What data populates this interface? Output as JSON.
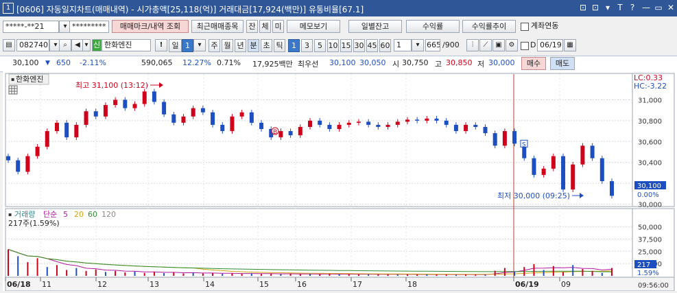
{
  "window": {
    "number": "1",
    "title": "[0606] 자동일지차트(매매내역) - 시가총액[25,118(억)] 거래대금[17,924(백만)] 유통비율[67.1]",
    "buttons": [
      "⊡",
      "⊡",
      "▾",
      "T",
      "?",
      "—",
      "▭",
      "✕"
    ]
  },
  "toolbar1": {
    "account": "*****-**21",
    "password": "*********",
    "trade_mark_btn": "매매마크/내역 조회",
    "recent_btn": "최근매매종목",
    "small_btns": [
      "잔",
      "체",
      "미"
    ],
    "memo_btn": "메모보기",
    "daily_btn": "일별잔고",
    "profit_btn": "수익률",
    "profit_rate_btn": "수익률추이",
    "link_label": "계좌연동"
  },
  "toolbar2": {
    "code": "082740",
    "badge": "신",
    "name": "한화엔진",
    "excl": "!",
    "period_day": "일",
    "period_num": "1",
    "periods": [
      "주",
      "월",
      "년",
      "분",
      "초",
      "틱"
    ],
    "intervals": [
      "1",
      "3",
      "5",
      "10",
      "15",
      "30",
      "45",
      "60"
    ],
    "interval_sel": "1",
    "count": "665",
    "count_total": "/900",
    "date_label": "D",
    "date": "06/19"
  },
  "quote": {
    "price": "30,100",
    "change": "650",
    "change_pct": "-2.11%",
    "volume": "590,065",
    "turnover_pct": "12.27%",
    "ratio": "0.71%",
    "amount": "17,925백만",
    "best_ask_label": "최우선",
    "best_ask": "30,100",
    "best_bid": "30,050",
    "open_label": "시",
    "open": "30,750",
    "high_label": "고",
    "high": "30,850",
    "low_label": "저",
    "low": "30,000",
    "buy_btn": "매수",
    "sell_btn": "매도"
  },
  "chart_data": [
    {
      "type": "candlestick",
      "title": "한화엔진",
      "price_axis": {
        "ticks": [
          "31,000",
          "30,800",
          "30,600",
          "30,400",
          "30,200",
          "30,000"
        ],
        "range": [
          29990,
          31220
        ]
      },
      "lc_label": "LC:0.33",
      "hc_label": "HC:-3.22",
      "current_price_label": "30,100",
      "current_pct_label": "0.00%",
      "high_annotation": "최고 31,100 (13:12)",
      "low_annotation": "최저 30,000 (09:25)",
      "trade_marks": [
        {
          "label": "B",
          "price": 30700
        },
        {
          "label": "S",
          "price": 30580
        }
      ],
      "x_labels": [
        "06/18",
        "11",
        "12",
        "13",
        "14",
        "15",
        "16",
        "17",
        "18",
        "06/19",
        "09"
      ],
      "time_label": "09:56:00",
      "closes": [
        30420,
        30310,
        30460,
        30550,
        30700,
        30780,
        30640,
        30760,
        30890,
        30840,
        30950,
        31000,
        30920,
        30960,
        31080,
        30980,
        30860,
        30780,
        30840,
        30920,
        30880,
        30760,
        30700,
        30840,
        30880,
        30780,
        30720,
        30640,
        30700,
        30660,
        30740,
        30800,
        30760,
        30720,
        30760,
        30780,
        30790,
        30760,
        30740,
        30760,
        30790,
        30810,
        30800,
        30820,
        30800,
        30760,
        30700,
        30760,
        30740,
        30680,
        30560,
        30700,
        30580,
        30440,
        30280,
        30340,
        30460,
        30140,
        30380,
        30560,
        30440,
        30220,
        30080
      ]
    },
    {
      "type": "bar",
      "title": "거래량",
      "ma_label": "단순",
      "ma_periods": [
        "5",
        "20",
        "60",
        "120"
      ],
      "volume_label": "217주(1.59%)",
      "axis_ticks": [
        "50,000",
        "37,500",
        "25,000",
        "12,500"
      ],
      "current_label": "217",
      "current_pct_label": "1.59%",
      "values": [
        27000,
        20000,
        14000,
        18000,
        9000,
        11000,
        6000,
        8000,
        5000,
        6500,
        4000,
        5000,
        3500,
        4500,
        3000,
        4000,
        2800,
        3500,
        2500,
        3200,
        2400,
        2800,
        2200,
        2600,
        2000,
        2400,
        1900,
        2200,
        1800,
        2100,
        1700,
        2000,
        1600,
        1900,
        1500,
        1800,
        1500,
        1700,
        1400,
        1600,
        1400,
        1500,
        1300,
        1500,
        1300,
        1400,
        1200,
        1400,
        1200,
        1300,
        5200,
        8000,
        4500,
        9000,
        12000,
        6000,
        10000,
        4000,
        11000,
        7000,
        5000,
        3000,
        8000
      ]
    }
  ]
}
